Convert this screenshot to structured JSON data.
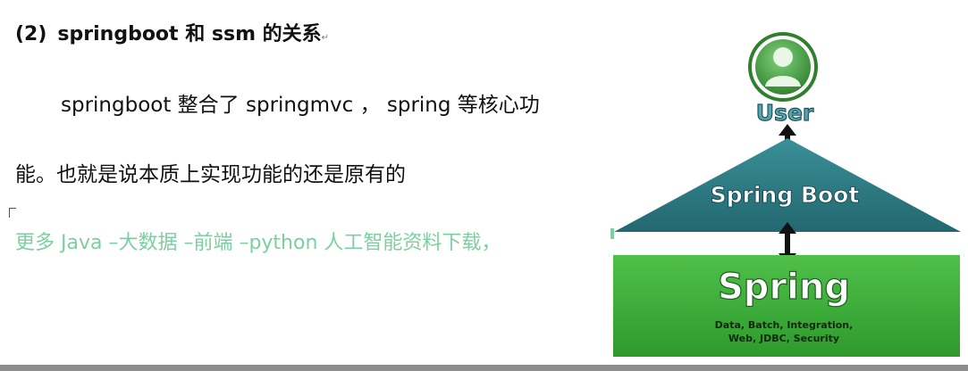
{
  "heading": {
    "number": "(2)",
    "title": "springboot 和 ssm 的关系",
    "para_mark": "↵"
  },
  "body": {
    "line1": "springboot 整合了 springmvc ， spring 等核心功",
    "line2": "能。也就是说本质上实现功能的还是原有的"
  },
  "promo": {
    "text": "更多 Java –大数据 –前端 –python 人工智能资料下载，"
  },
  "diagram": {
    "user_label": "User",
    "boot_label": "Spring Boot",
    "spring_label": "Spring",
    "modules_line1": "Data, Batch, Integration,",
    "modules_line2": "Web, JDBC, Security",
    "colors": {
      "user_green": "#3d9a3a",
      "boot_teal": "#2e7b83",
      "spring_green": "#3fae3a",
      "arrow": "#111111"
    }
  }
}
